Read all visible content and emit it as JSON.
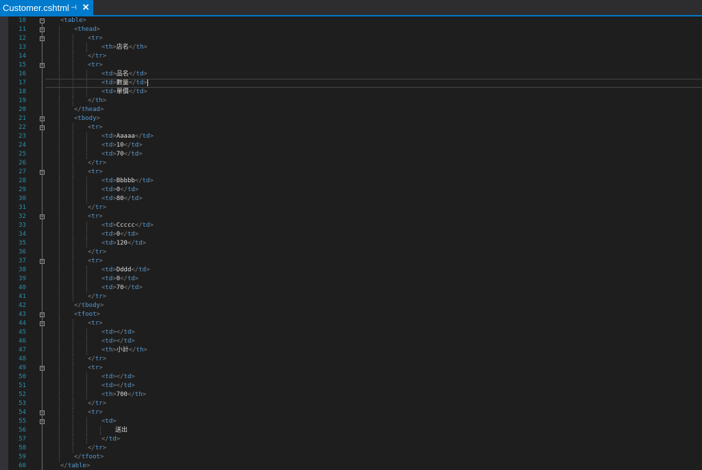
{
  "tab": {
    "title": "Customer.cshtml",
    "pin_glyph": "⊣",
    "close_glyph": "✕"
  },
  "lines": [
    {
      "n": "10",
      "indent": 1,
      "fold": true,
      "parts": [
        [
          "b",
          "<"
        ],
        [
          "t",
          "table"
        ],
        [
          "b",
          ">"
        ]
      ]
    },
    {
      "n": "11",
      "indent": 2,
      "fold": true,
      "parts": [
        [
          "b",
          "<"
        ],
        [
          "t",
          "thead"
        ],
        [
          "b",
          ">"
        ]
      ]
    },
    {
      "n": "12",
      "indent": 3,
      "fold": true,
      "parts": [
        [
          "b",
          "<"
        ],
        [
          "t",
          "tr"
        ],
        [
          "b",
          ">"
        ]
      ]
    },
    {
      "n": "13",
      "indent": 4,
      "parts": [
        [
          "b",
          "<"
        ],
        [
          "t",
          "th"
        ],
        [
          "b",
          ">"
        ],
        [
          "x",
          "店名"
        ],
        [
          "b",
          "</"
        ],
        [
          "t",
          "th"
        ],
        [
          "b",
          ">"
        ]
      ]
    },
    {
      "n": "14",
      "indent": 3,
      "parts": [
        [
          "b",
          "</"
        ],
        [
          "t",
          "tr"
        ],
        [
          "b",
          ">"
        ]
      ]
    },
    {
      "n": "15",
      "indent": 3,
      "fold": true,
      "parts": [
        [
          "b",
          "<"
        ],
        [
          "t",
          "tr"
        ],
        [
          "b",
          ">"
        ]
      ]
    },
    {
      "n": "16",
      "indent": 4,
      "parts": [
        [
          "b",
          "<"
        ],
        [
          "t",
          "td"
        ],
        [
          "b",
          ">"
        ],
        [
          "x",
          "品名"
        ],
        [
          "b",
          "</"
        ],
        [
          "t",
          "td"
        ],
        [
          "b",
          ">"
        ]
      ]
    },
    {
      "n": "17",
      "indent": 4,
      "current": true,
      "caret": true,
      "parts": [
        [
          "b",
          "<"
        ],
        [
          "t",
          "td"
        ],
        [
          "b",
          ">"
        ],
        [
          "x",
          "數量"
        ],
        [
          "b",
          "</"
        ],
        [
          "t",
          "td"
        ],
        [
          "b",
          ">"
        ]
      ]
    },
    {
      "n": "18",
      "indent": 4,
      "parts": [
        [
          "b",
          "<"
        ],
        [
          "t",
          "td"
        ],
        [
          "b",
          ">"
        ],
        [
          "x",
          "單價"
        ],
        [
          "b",
          "</"
        ],
        [
          "t",
          "td"
        ],
        [
          "b",
          ">"
        ]
      ]
    },
    {
      "n": "19",
      "indent": 3,
      "parts": [
        [
          "b",
          "</"
        ],
        [
          "t",
          "th"
        ],
        [
          "b",
          ">"
        ]
      ]
    },
    {
      "n": "20",
      "indent": 2,
      "parts": [
        [
          "b",
          "</"
        ],
        [
          "t",
          "thead"
        ],
        [
          "b",
          ">"
        ]
      ]
    },
    {
      "n": "21",
      "indent": 2,
      "fold": true,
      "parts": [
        [
          "b",
          "<"
        ],
        [
          "t",
          "tbody"
        ],
        [
          "b",
          ">"
        ]
      ]
    },
    {
      "n": "22",
      "indent": 3,
      "fold": true,
      "parts": [
        [
          "b",
          "<"
        ],
        [
          "t",
          "tr"
        ],
        [
          "b",
          ">"
        ]
      ]
    },
    {
      "n": "23",
      "indent": 4,
      "parts": [
        [
          "b",
          "<"
        ],
        [
          "t",
          "td"
        ],
        [
          "b",
          ">"
        ],
        [
          "x",
          "Aaaaa"
        ],
        [
          "b",
          "</"
        ],
        [
          "t",
          "td"
        ],
        [
          "b",
          ">"
        ]
      ]
    },
    {
      "n": "24",
      "indent": 4,
      "parts": [
        [
          "b",
          "<"
        ],
        [
          "t",
          "td"
        ],
        [
          "b",
          ">"
        ],
        [
          "x",
          "10"
        ],
        [
          "b",
          "</"
        ],
        [
          "t",
          "td"
        ],
        [
          "b",
          ">"
        ]
      ]
    },
    {
      "n": "25",
      "indent": 4,
      "parts": [
        [
          "b",
          "<"
        ],
        [
          "t",
          "td"
        ],
        [
          "b",
          ">"
        ],
        [
          "x",
          "70"
        ],
        [
          "b",
          "</"
        ],
        [
          "t",
          "td"
        ],
        [
          "b",
          ">"
        ]
      ]
    },
    {
      "n": "26",
      "indent": 3,
      "parts": [
        [
          "b",
          "</"
        ],
        [
          "t",
          "tr"
        ],
        [
          "b",
          ">"
        ]
      ]
    },
    {
      "n": "27",
      "indent": 3,
      "fold": true,
      "parts": [
        [
          "b",
          "<"
        ],
        [
          "t",
          "tr"
        ],
        [
          "b",
          ">"
        ]
      ]
    },
    {
      "n": "28",
      "indent": 4,
      "parts": [
        [
          "b",
          "<"
        ],
        [
          "t",
          "td"
        ],
        [
          "b",
          ">"
        ],
        [
          "x",
          "Bbbbb"
        ],
        [
          "b",
          "</"
        ],
        [
          "t",
          "td"
        ],
        [
          "b",
          ">"
        ]
      ]
    },
    {
      "n": "29",
      "indent": 4,
      "parts": [
        [
          "b",
          "<"
        ],
        [
          "t",
          "td"
        ],
        [
          "b",
          ">"
        ],
        [
          "x",
          "0"
        ],
        [
          "b",
          "</"
        ],
        [
          "t",
          "td"
        ],
        [
          "b",
          ">"
        ]
      ]
    },
    {
      "n": "30",
      "indent": 4,
      "parts": [
        [
          "b",
          "<"
        ],
        [
          "t",
          "td"
        ],
        [
          "b",
          ">"
        ],
        [
          "x",
          "80"
        ],
        [
          "b",
          "</"
        ],
        [
          "t",
          "td"
        ],
        [
          "b",
          ">"
        ]
      ]
    },
    {
      "n": "31",
      "indent": 3,
      "parts": [
        [
          "b",
          "</"
        ],
        [
          "t",
          "tr"
        ],
        [
          "b",
          ">"
        ]
      ]
    },
    {
      "n": "32",
      "indent": 3,
      "fold": true,
      "parts": [
        [
          "b",
          "<"
        ],
        [
          "t",
          "tr"
        ],
        [
          "b",
          ">"
        ]
      ]
    },
    {
      "n": "33",
      "indent": 4,
      "parts": [
        [
          "b",
          "<"
        ],
        [
          "t",
          "td"
        ],
        [
          "b",
          ">"
        ],
        [
          "x",
          "Ccccc"
        ],
        [
          "b",
          "</"
        ],
        [
          "t",
          "td"
        ],
        [
          "b",
          ">"
        ]
      ]
    },
    {
      "n": "34",
      "indent": 4,
      "parts": [
        [
          "b",
          "<"
        ],
        [
          "t",
          "td"
        ],
        [
          "b",
          ">"
        ],
        [
          "x",
          "0"
        ],
        [
          "b",
          "</"
        ],
        [
          "t",
          "td"
        ],
        [
          "b",
          ">"
        ]
      ]
    },
    {
      "n": "35",
      "indent": 4,
      "parts": [
        [
          "b",
          "<"
        ],
        [
          "t",
          "td"
        ],
        [
          "b",
          ">"
        ],
        [
          "x",
          "120"
        ],
        [
          "b",
          "</"
        ],
        [
          "t",
          "td"
        ],
        [
          "b",
          ">"
        ]
      ]
    },
    {
      "n": "36",
      "indent": 3,
      "parts": [
        [
          "b",
          "</"
        ],
        [
          "t",
          "tr"
        ],
        [
          "b",
          ">"
        ]
      ]
    },
    {
      "n": "37",
      "indent": 3,
      "fold": true,
      "parts": [
        [
          "b",
          "<"
        ],
        [
          "t",
          "tr"
        ],
        [
          "b",
          ">"
        ]
      ]
    },
    {
      "n": "38",
      "indent": 4,
      "parts": [
        [
          "b",
          "<"
        ],
        [
          "t",
          "td"
        ],
        [
          "b",
          ">"
        ],
        [
          "x",
          "Dddd"
        ],
        [
          "b",
          "</"
        ],
        [
          "t",
          "td"
        ],
        [
          "b",
          ">"
        ]
      ]
    },
    {
      "n": "39",
      "indent": 4,
      "parts": [
        [
          "b",
          "<"
        ],
        [
          "t",
          "td"
        ],
        [
          "b",
          ">"
        ],
        [
          "x",
          "0"
        ],
        [
          "b",
          "</"
        ],
        [
          "t",
          "td"
        ],
        [
          "b",
          ">"
        ]
      ]
    },
    {
      "n": "40",
      "indent": 4,
      "parts": [
        [
          "b",
          "<"
        ],
        [
          "t",
          "td"
        ],
        [
          "b",
          ">"
        ],
        [
          "x",
          "70"
        ],
        [
          "b",
          "</"
        ],
        [
          "t",
          "td"
        ],
        [
          "b",
          ">"
        ]
      ]
    },
    {
      "n": "41",
      "indent": 3,
      "parts": [
        [
          "b",
          "</"
        ],
        [
          "t",
          "tr"
        ],
        [
          "b",
          ">"
        ]
      ]
    },
    {
      "n": "42",
      "indent": 2,
      "parts": [
        [
          "b",
          "</"
        ],
        [
          "t",
          "tbody"
        ],
        [
          "b",
          ">"
        ]
      ]
    },
    {
      "n": "43",
      "indent": 2,
      "fold": true,
      "parts": [
        [
          "b",
          "<"
        ],
        [
          "t",
          "tfoot"
        ],
        [
          "b",
          ">"
        ]
      ]
    },
    {
      "n": "44",
      "indent": 3,
      "fold": true,
      "parts": [
        [
          "b",
          "<"
        ],
        [
          "t",
          "tr"
        ],
        [
          "b",
          ">"
        ]
      ]
    },
    {
      "n": "45",
      "indent": 4,
      "parts": [
        [
          "b",
          "<"
        ],
        [
          "t",
          "td"
        ],
        [
          "b",
          "></"
        ],
        [
          "t",
          "td"
        ],
        [
          "b",
          ">"
        ]
      ]
    },
    {
      "n": "46",
      "indent": 4,
      "parts": [
        [
          "b",
          "<"
        ],
        [
          "t",
          "td"
        ],
        [
          "b",
          "></"
        ],
        [
          "t",
          "td"
        ],
        [
          "b",
          ">"
        ]
      ]
    },
    {
      "n": "47",
      "indent": 4,
      "parts": [
        [
          "b",
          "<"
        ],
        [
          "t",
          "th"
        ],
        [
          "b",
          ">"
        ],
        [
          "x",
          "小計"
        ],
        [
          "b",
          "</"
        ],
        [
          "t",
          "th"
        ],
        [
          "b",
          ">"
        ]
      ]
    },
    {
      "n": "48",
      "indent": 3,
      "parts": [
        [
          "b",
          "</"
        ],
        [
          "t",
          "tr"
        ],
        [
          "b",
          ">"
        ]
      ]
    },
    {
      "n": "49",
      "indent": 3,
      "fold": true,
      "parts": [
        [
          "b",
          "<"
        ],
        [
          "t",
          "tr"
        ],
        [
          "b",
          ">"
        ]
      ]
    },
    {
      "n": "50",
      "indent": 4,
      "parts": [
        [
          "b",
          "<"
        ],
        [
          "t",
          "td"
        ],
        [
          "b",
          "></"
        ],
        [
          "t",
          "td"
        ],
        [
          "b",
          ">"
        ]
      ]
    },
    {
      "n": "51",
      "indent": 4,
      "parts": [
        [
          "b",
          "<"
        ],
        [
          "t",
          "td"
        ],
        [
          "b",
          "></"
        ],
        [
          "t",
          "td"
        ],
        [
          "b",
          ">"
        ]
      ]
    },
    {
      "n": "52",
      "indent": 4,
      "parts": [
        [
          "b",
          "<"
        ],
        [
          "t",
          "th"
        ],
        [
          "b",
          ">"
        ],
        [
          "x",
          "700"
        ],
        [
          "b",
          "</"
        ],
        [
          "t",
          "th"
        ],
        [
          "b",
          ">"
        ]
      ]
    },
    {
      "n": "53",
      "indent": 3,
      "parts": [
        [
          "b",
          "</"
        ],
        [
          "t",
          "tr"
        ],
        [
          "b",
          ">"
        ]
      ]
    },
    {
      "n": "54",
      "indent": 3,
      "fold": true,
      "parts": [
        [
          "b",
          "<"
        ],
        [
          "t",
          "tr"
        ],
        [
          "b",
          ">"
        ]
      ]
    },
    {
      "n": "55",
      "indent": 4,
      "fold": true,
      "parts": [
        [
          "b",
          "<"
        ],
        [
          "t",
          "td"
        ],
        [
          "b",
          ">"
        ]
      ]
    },
    {
      "n": "56",
      "indent": 5,
      "parts": [
        [
          "x",
          "送出"
        ]
      ]
    },
    {
      "n": "57",
      "indent": 4,
      "parts": [
        [
          "b",
          "</"
        ],
        [
          "t",
          "td"
        ],
        [
          "b",
          ">"
        ]
      ]
    },
    {
      "n": "58",
      "indent": 3,
      "parts": [
        [
          "b",
          "</"
        ],
        [
          "t",
          "tr"
        ],
        [
          "b",
          ">"
        ]
      ]
    },
    {
      "n": "59",
      "indent": 2,
      "parts": [
        [
          "b",
          "</"
        ],
        [
          "t",
          "tfoot"
        ],
        [
          "b",
          ">"
        ]
      ]
    },
    {
      "n": "60",
      "indent": 1,
      "parts": [
        [
          "b",
          "</"
        ],
        [
          "t",
          "table"
        ],
        [
          "b",
          ">"
        ]
      ]
    }
  ]
}
